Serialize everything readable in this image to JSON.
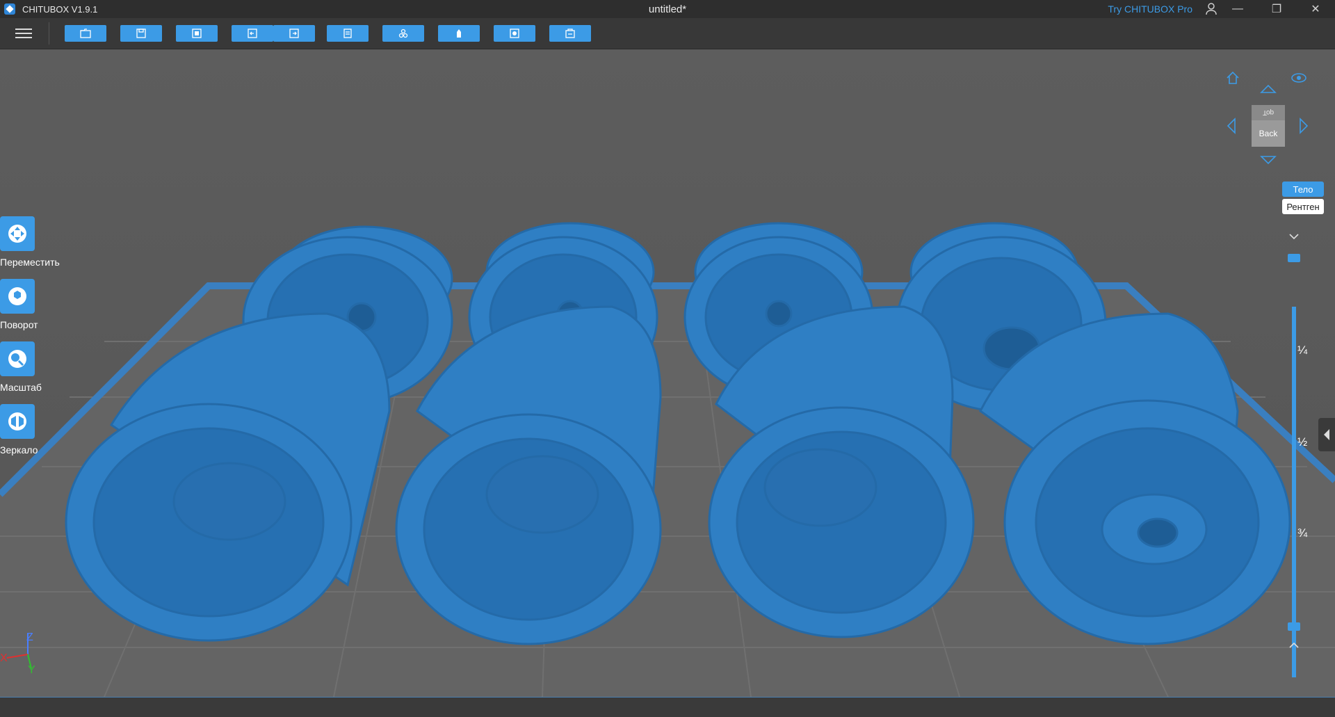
{
  "app": {
    "name": "CHITUBOX V1.9.1",
    "doc_title": "untitled*",
    "try_pro": "Try CHITUBOX Pro"
  },
  "window_controls": {
    "minimize": "—",
    "maximize": "❐",
    "close": "✕"
  },
  "toolbar": {
    "buttons": [
      "open-file-icon",
      "save-icon",
      "select-icon",
      "undo-icon",
      "redo-icon",
      "layout-icon",
      "slice-settings-icon",
      "support-icon",
      "hollow-icon",
      "slice-icon"
    ]
  },
  "left_tools": [
    {
      "label": "Переместить",
      "icon": "move-icon"
    },
    {
      "label": "Поворот",
      "icon": "rotate-icon"
    },
    {
      "label": "Масштаб",
      "icon": "scale-icon"
    },
    {
      "label": "Зеркало",
      "icon": "mirror-icon"
    }
  ],
  "view_cube": {
    "top_label": "Top",
    "front_label": "Back"
  },
  "view_modes": {
    "solid": "Тело",
    "xray": "Рентген"
  },
  "layer_slider": {
    "ticks": [
      "¼",
      "½",
      "¾"
    ],
    "top_value": 1,
    "bottom_value": 0
  },
  "axes": {
    "z": "Z",
    "x": "X",
    "y": "Y"
  },
  "colors": {
    "accent": "#3c9be6",
    "model": "#2f7fc4",
    "plate": "#3a7fc0"
  }
}
